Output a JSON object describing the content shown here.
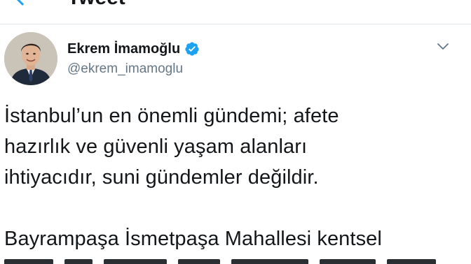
{
  "header": {
    "title": "Tweet"
  },
  "tweet": {
    "author": {
      "display_name": "Ekrem İmamoğlu",
      "handle": "@ekrem_imamoglu",
      "verified": true
    },
    "lines": [
      "İstanbul’un en önemli gündemi; afete",
      "hazırlık ve güvenli yaşam alanları",
      "ihtiyacıdır, suni gündemler değildir.",
      "",
      "Bayrampaşa İsmetpaşa Mahallesi kentsel"
    ]
  },
  "colors": {
    "text": "#14171a",
    "secondary": "#657786",
    "verified": "#1da1f2",
    "divider": "#e1e8ed"
  },
  "icons": [
    "back-arrow-icon",
    "verified-badge-icon",
    "chevron-down-icon"
  ]
}
